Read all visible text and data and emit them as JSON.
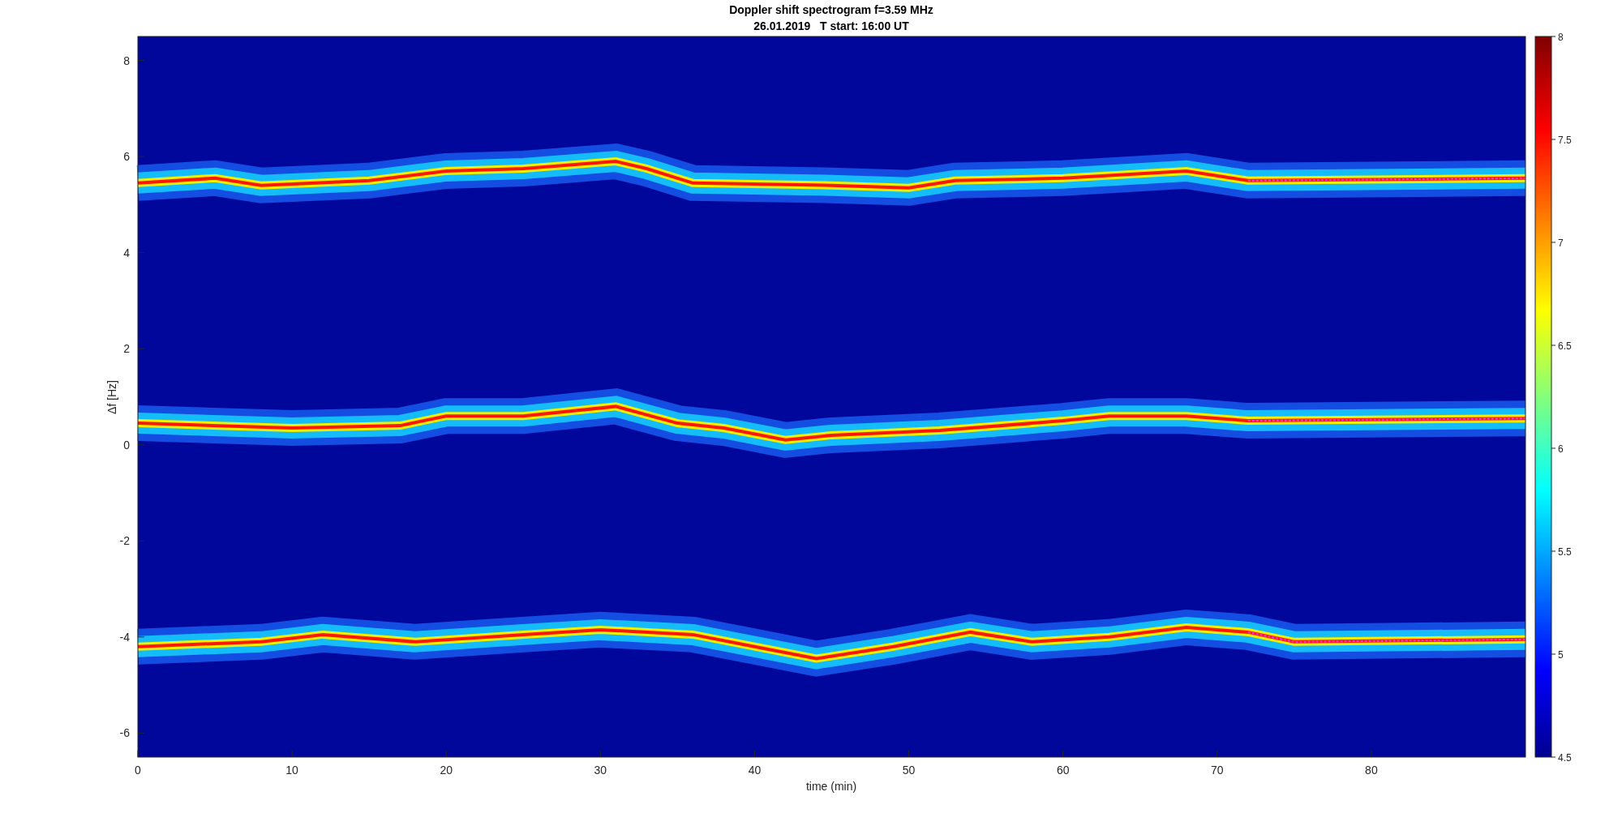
{
  "title": {
    "line_1": "Doppler shift spectrogram f=3.59 MHz",
    "line_2": "26.01.2019   T start: 16:00 UT"
  },
  "y_axis": {
    "label": "Δf [Hz]",
    "ticks": [
      "8",
      "6",
      "4",
      "2",
      "0",
      "-2",
      "-4",
      "-6"
    ]
  },
  "x_axis": {
    "label": "time (min)",
    "ticks": [
      "0",
      "10",
      "20",
      "30",
      "40",
      "50",
      "60",
      "70",
      "80"
    ]
  },
  "colorbar": {
    "ticks": [
      "8",
      "7.5",
      "7",
      "6.5",
      "6",
      "5.5",
      "5",
      "4.5"
    ]
  }
}
